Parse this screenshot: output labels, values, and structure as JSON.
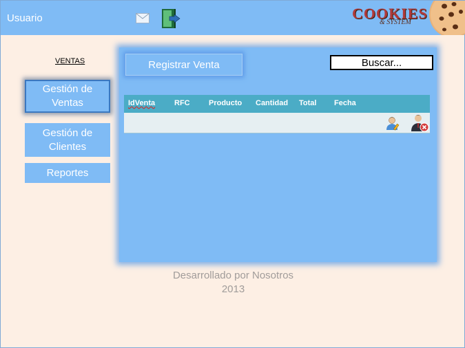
{
  "header": {
    "user_label": "Usuario",
    "logo_main": "COOKIES",
    "logo_sub": "& SYSTEM"
  },
  "sidebar": {
    "section_title": "VENTAS",
    "items": [
      {
        "label": "Gestión de Ventas",
        "active": true
      },
      {
        "label": "Gestión de Clientes",
        "active": false
      },
      {
        "label": "Reportes",
        "active": false
      }
    ]
  },
  "main": {
    "register_button": "Registrar Venta",
    "search_value": "Buscar...",
    "table": {
      "columns": [
        "IdVenta",
        "RFC",
        "Producto",
        "Cantidad",
        "Total",
        "Fecha"
      ]
    }
  },
  "footer": {
    "line1": "Desarrollado por Nosotros",
    "line2": "2013"
  },
  "colors": {
    "header": "#7fbbf5",
    "panel": "#7fbbf5",
    "background": "#fdefe4",
    "table_header": "#4bacc6"
  },
  "icons": [
    "mail-icon",
    "exit-door-icon",
    "cookie-icon",
    "edit-user-icon",
    "delete-user-icon"
  ]
}
